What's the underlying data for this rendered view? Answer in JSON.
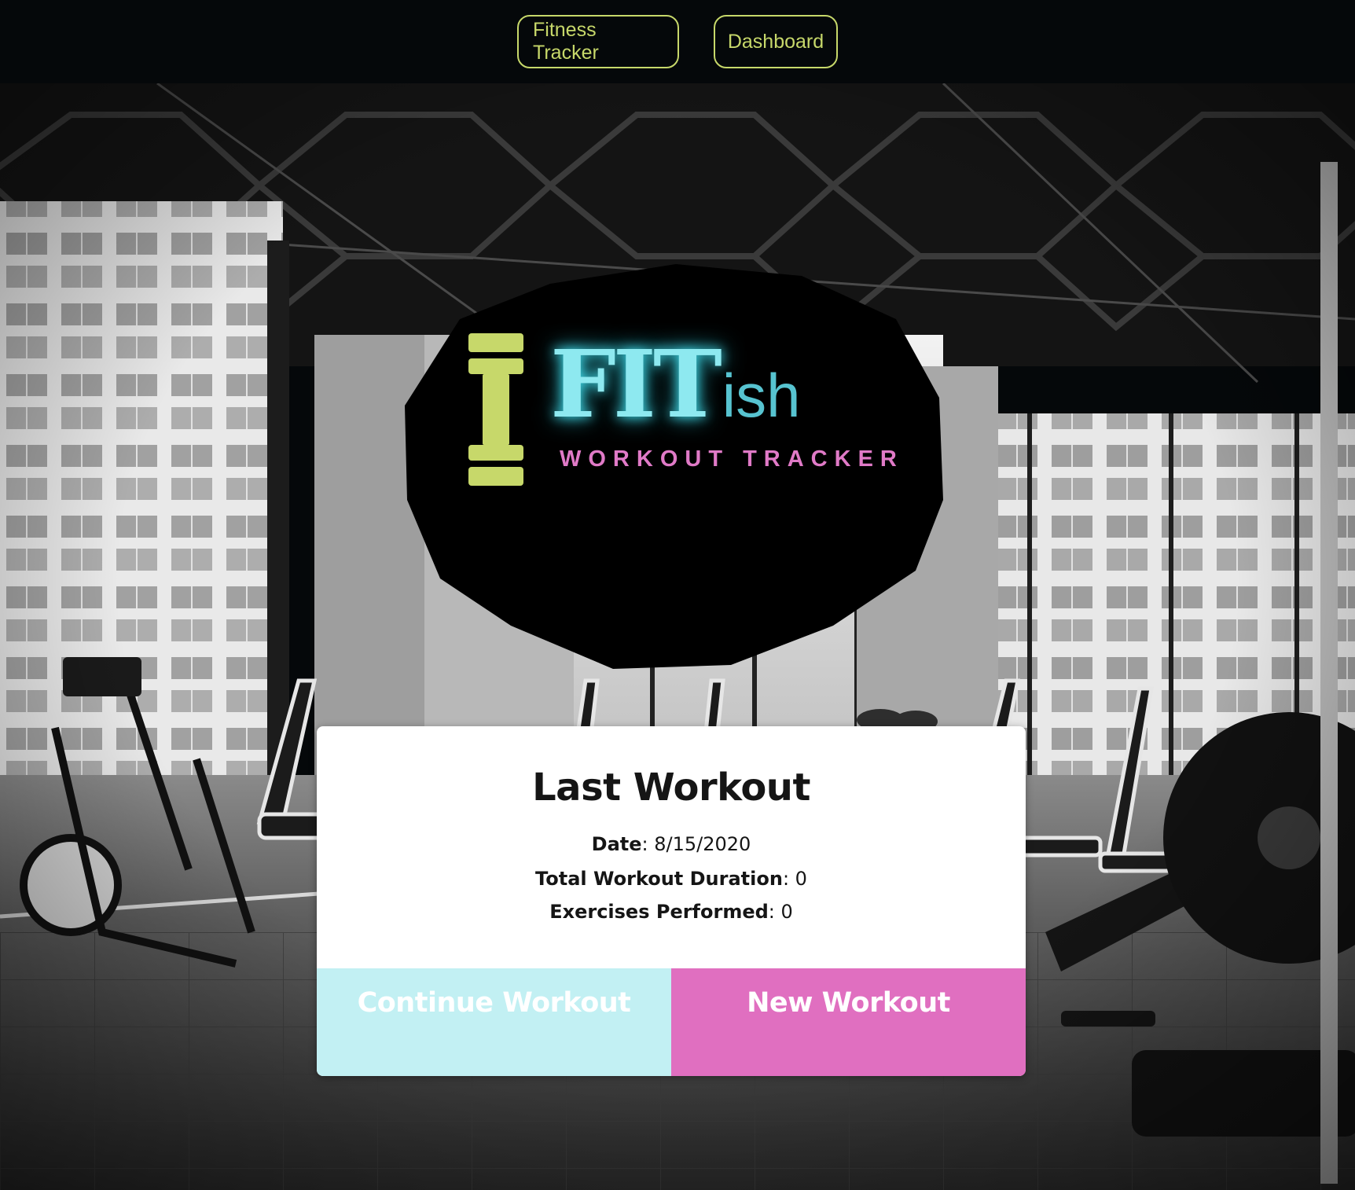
{
  "nav": {
    "items": [
      {
        "label": "Fitness Tracker"
      },
      {
        "label": "Dashboard"
      }
    ],
    "accent_color": "#c7d86a"
  },
  "logo": {
    "brand_bold": "FIT",
    "brand_suffix": "ish",
    "tagline": "WORKOUT TRACKER",
    "colors": {
      "dumbbell": "#c7d86a",
      "brand": "#8ee9f0",
      "suffix": "#57c3d0",
      "tagline": "#e07ac7"
    }
  },
  "last_workout": {
    "title": "Last Workout",
    "date_label": "Date",
    "date_value": "8/15/2020",
    "duration_label": "Total Workout Duration",
    "duration_value": "0",
    "exercises_label": "Exercises Performed",
    "exercises_value": "0"
  },
  "actions": {
    "continue_label": "Continue Workout",
    "new_label": "New Workout",
    "continue_color": "#c2f0f3",
    "new_color": "#e06fc0"
  },
  "background": {
    "icon": "gym-photo"
  }
}
